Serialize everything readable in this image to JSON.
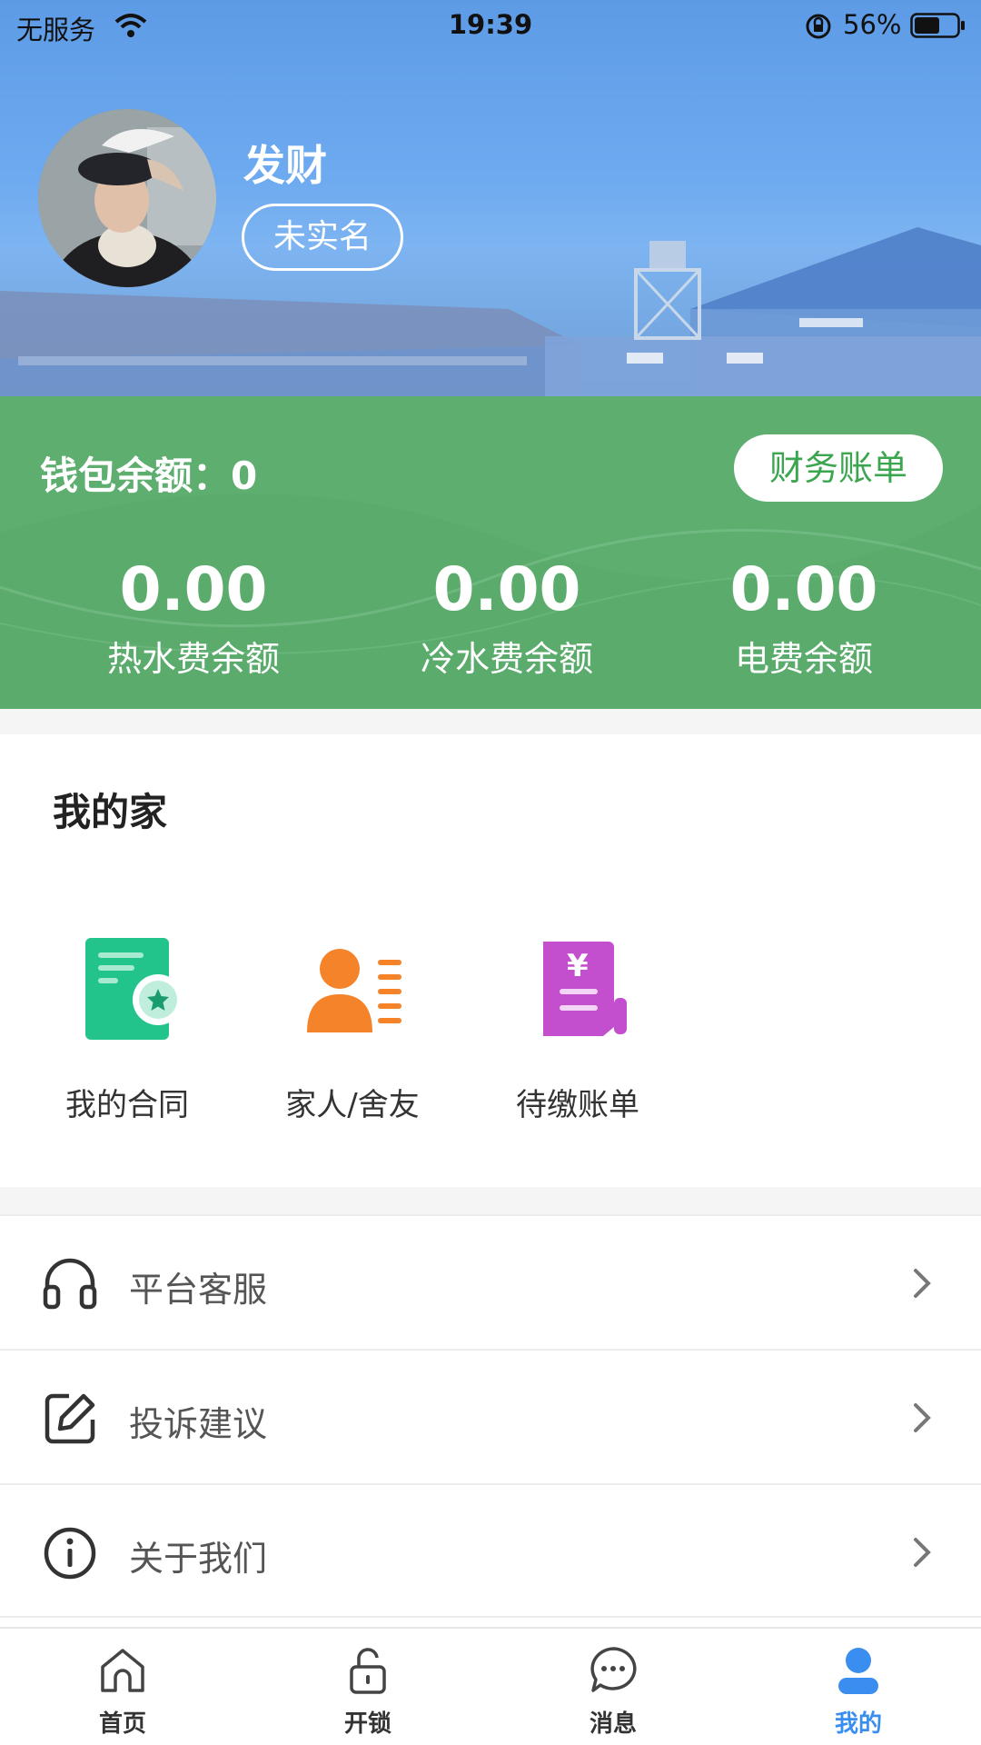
{
  "status_bar": {
    "carrier": "无服务",
    "time": "19:39",
    "battery": "56%"
  },
  "profile": {
    "name": "发财",
    "verify_status": "未实名"
  },
  "wallet": {
    "balance_label": "钱包余额：0",
    "bill_button": "财务账单",
    "stats": [
      {
        "value": "0.00",
        "label": "热水费余额"
      },
      {
        "value": "0.00",
        "label": "冷水费余额"
      },
      {
        "value": "0.00",
        "label": "电费余额"
      }
    ]
  },
  "home": {
    "title": "我的家",
    "items": [
      {
        "label": "我的合同",
        "icon": "contract-icon",
        "color": "#23c48b"
      },
      {
        "label": "家人/舍友",
        "icon": "family-icon",
        "color": "#f5832a"
      },
      {
        "label": "待缴账单",
        "icon": "bill-icon",
        "color": "#c34fcf"
      }
    ]
  },
  "menu": [
    {
      "label": "平台客服",
      "icon": "headset-icon"
    },
    {
      "label": "投诉建议",
      "icon": "edit-icon"
    },
    {
      "label": "关于我们",
      "icon": "info-icon"
    }
  ],
  "tabbar": {
    "tabs": [
      {
        "label": "首页",
        "icon": "home-icon"
      },
      {
        "label": "开锁",
        "icon": "unlock-icon"
      },
      {
        "label": "消息",
        "icon": "message-icon"
      },
      {
        "label": "我的",
        "icon": "user-icon"
      }
    ],
    "active_color": "#3a8ef0"
  },
  "colors": {
    "wallet_bg": "#5bab6d",
    "bill_text": "#3ba64f"
  }
}
